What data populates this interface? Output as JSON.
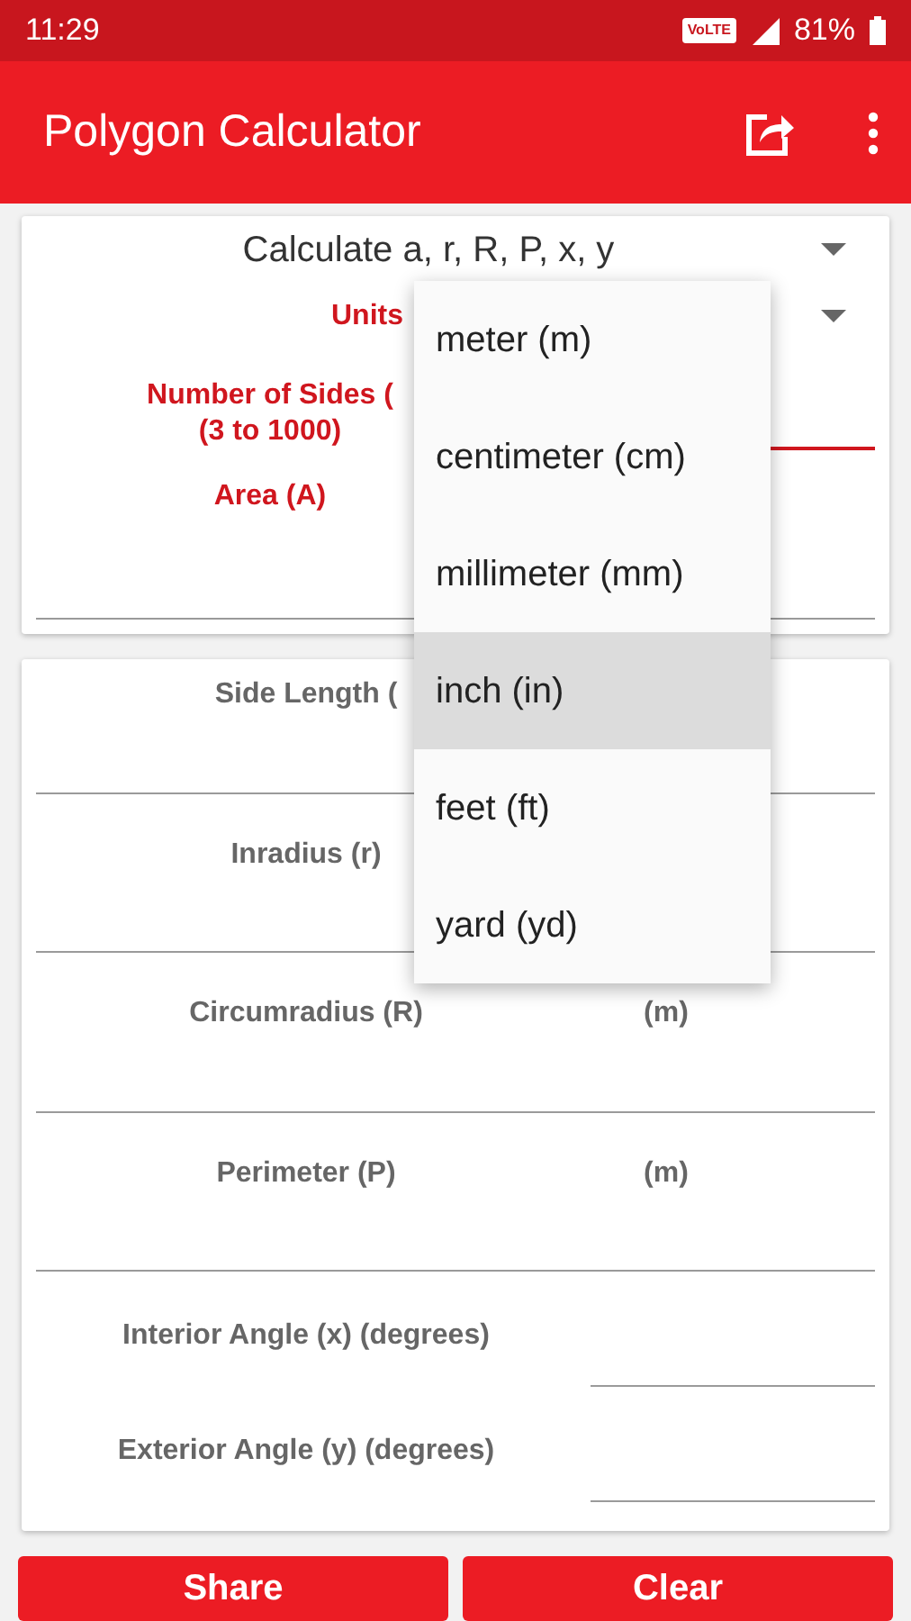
{
  "status_bar": {
    "time": "11:29",
    "network": "VoLTE",
    "battery": "81%"
  },
  "app_bar": {
    "title": "Polygon Calculator"
  },
  "mode_select": {
    "value": "Calculate a, r, R, P, x, y"
  },
  "inputs": [
    {
      "kind": "select",
      "label": "Units"
    },
    {
      "kind": "field",
      "label": "Number of Sides (",
      "sublabel": "(3 to 1000)",
      "focused": true
    },
    {
      "kind": "stacked",
      "label": "Area (A)",
      "focused": false
    }
  ],
  "results": [
    {
      "kind": "stacked",
      "label": "Side Length ("
    },
    {
      "kind": "stacked",
      "label": "Inradius (r)"
    },
    {
      "kind": "stacked",
      "label": "Circumradius (R)",
      "unit": "(m)"
    },
    {
      "kind": "stacked",
      "label": "Perimeter (P)",
      "unit": "(m)"
    },
    {
      "kind": "inline",
      "label": "Interior Angle (x) (degrees)"
    },
    {
      "kind": "inline",
      "label": "Exterior Angle (y) (degrees)"
    }
  ],
  "units_menu": [
    {
      "label": "meter (m)",
      "selected": false
    },
    {
      "label": "centimeter (cm)",
      "selected": false
    },
    {
      "label": "millimeter (mm)",
      "selected": false
    },
    {
      "label": "inch (in)",
      "selected": true
    },
    {
      "label": "feet (ft)",
      "selected": false
    },
    {
      "label": "yard (yd)",
      "selected": false
    }
  ],
  "buttons": [
    "Share",
    "Clear"
  ]
}
